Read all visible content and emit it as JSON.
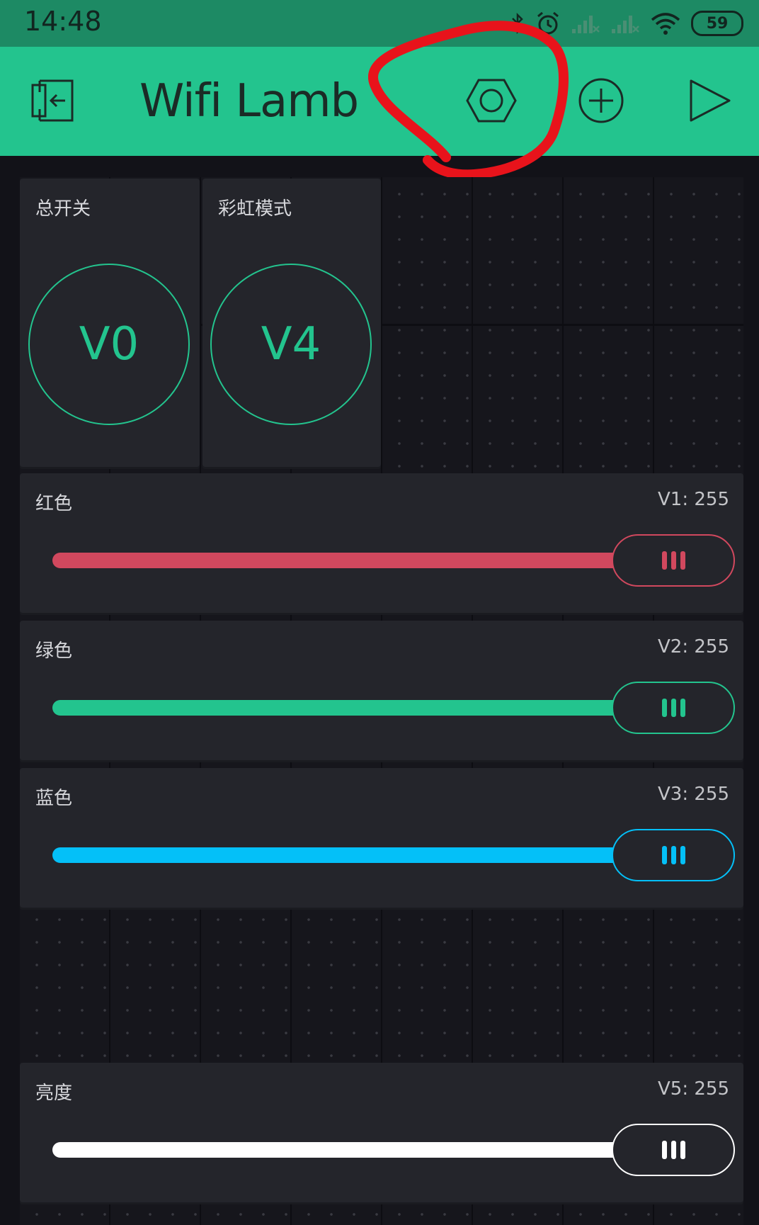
{
  "status_bar": {
    "time": "14:48",
    "battery": "59"
  },
  "app_bar": {
    "title": "Wifi Lamb"
  },
  "buttons": [
    {
      "label": "总开关",
      "pin": "V0"
    },
    {
      "label": "彩虹模式",
      "pin": "V4"
    }
  ],
  "sliders": [
    {
      "label": "红色",
      "value_text": "V1: 255",
      "value": 255,
      "color": "#d1485e"
    },
    {
      "label": "绿色",
      "value_text": "V2: 255",
      "value": 255,
      "color": "#23c48e"
    },
    {
      "label": "蓝色",
      "value_text": "V3: 255",
      "value": 255,
      "color": "#04c0f8"
    },
    {
      "label": "亮度",
      "value_text": "V5: 255",
      "value": 255,
      "color": "#ffffff"
    }
  ],
  "colors": {
    "accent": "#23c48e",
    "status_bar": "#1d8a64",
    "background": "#121218",
    "annotation": "#e8131b"
  }
}
